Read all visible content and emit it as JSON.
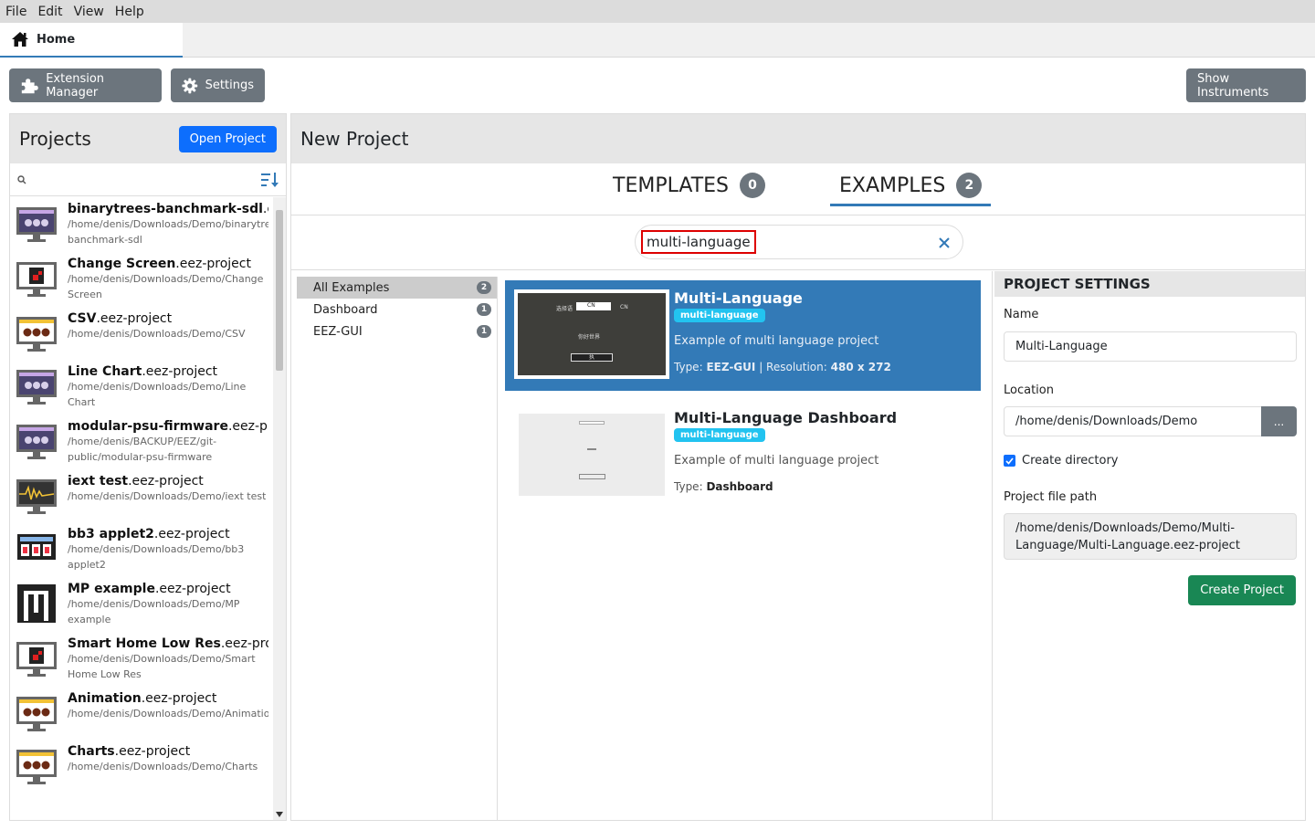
{
  "menu": [
    "File",
    "Edit",
    "View",
    "Help"
  ],
  "tab": {
    "label": "Home"
  },
  "toolbar": {
    "extension_manager": "Extension Manager",
    "settings": "Settings",
    "show_instruments": "Show Instruments"
  },
  "projects": {
    "title": "Projects",
    "open_button": "Open Project",
    "items": [
      {
        "name": "binarytrees-banchmark-sdl",
        "ext": ".eez-project",
        "path": "/home/denis/Downloads/Demo/binarytrees-banchmark-sdl",
        "icon": "dashboard-purple-icon"
      },
      {
        "name": "Change Screen",
        "ext": ".eez-project",
        "path": "/home/denis/Downloads/Demo/Change Screen",
        "icon": "lvgl-red-icon"
      },
      {
        "name": "CSV",
        "ext": ".eez-project",
        "path": "/home/denis/Downloads/Demo/CSV",
        "icon": "monitor-yellow-icon"
      },
      {
        "name": "Line Chart",
        "ext": ".eez-project",
        "path": "/home/denis/Downloads/Demo/Line Chart",
        "icon": "dashboard-purple-icon"
      },
      {
        "name": "modular-psu-firmware",
        "ext": ".eez-project",
        "path": "/home/denis/BACKUP/EEZ/git-public/modular-psu-firmware",
        "icon": "dashboard-purple-icon"
      },
      {
        "name": "iext test",
        "ext": ".eez-project",
        "path": "/home/denis/Downloads/Demo/iext test",
        "icon": "monitor-wave-icon"
      },
      {
        "name": "bb3 applet2",
        "ext": ".eez-project",
        "path": "/home/denis/Downloads/Demo/bb3 applet2",
        "icon": "bb3-icon"
      },
      {
        "name": "MP example",
        "ext": ".eez-project",
        "path": "/home/denis/Downloads/Demo/MP example",
        "icon": "micropython-icon"
      },
      {
        "name": "Smart Home Low Res",
        "ext": ".eez-project",
        "path": "/home/denis/Downloads/Demo/Smart Home Low Res",
        "icon": "lvgl-red-icon"
      },
      {
        "name": "Animation",
        "ext": ".eez-project",
        "path": "/home/denis/Downloads/Demo/Animation",
        "icon": "monitor-yellow-icon"
      },
      {
        "name": "Charts",
        "ext": ".eez-project",
        "path": "/home/denis/Downloads/Demo/Charts",
        "icon": "monitor-yellow-icon"
      }
    ]
  },
  "new_project": {
    "title": "New Project",
    "tabs": [
      {
        "label": "TEMPLATES",
        "count": "0"
      },
      {
        "label": "EXAMPLES",
        "count": "2"
      }
    ],
    "search_value": "multi-language",
    "categories": [
      {
        "label": "All Examples",
        "count": "2"
      },
      {
        "label": "Dashboard",
        "count": "1"
      },
      {
        "label": "EEZ-GUI",
        "count": "1"
      }
    ],
    "examples": [
      {
        "title": "Multi-Language",
        "tag": "multi-language",
        "description": "Example of multi language project",
        "type_label": "Type:",
        "type": "EEZ-GUI",
        "sep": " | Resolution:",
        "resolution": "480 x 272",
        "thumb_text": [
          "选择语",
          "CN",
          "CN",
          "你好世界",
          "执"
        ]
      },
      {
        "title": "Multi-Language Dashboard",
        "tag": "multi-language",
        "description": "Example of multi language project",
        "type_label": "Type:",
        "type": "Dashboard"
      }
    ]
  },
  "settings": {
    "title": "PROJECT SETTINGS",
    "name_label": "Name",
    "name_value": "Multi-Language",
    "location_label": "Location",
    "location_value": "/home/denis/Downloads/Demo",
    "browse_label": "...",
    "create_dir_label": "Create directory",
    "path_label": "Project file path",
    "path_value": "/home/denis/Downloads/Demo/Multi-Language/Multi-Language.eez-project",
    "create_button": "Create Project"
  },
  "colors": {
    "accent": "#337ab7",
    "primary": "#0d6efd",
    "success": "#198754",
    "tag": "#22c3f0"
  }
}
